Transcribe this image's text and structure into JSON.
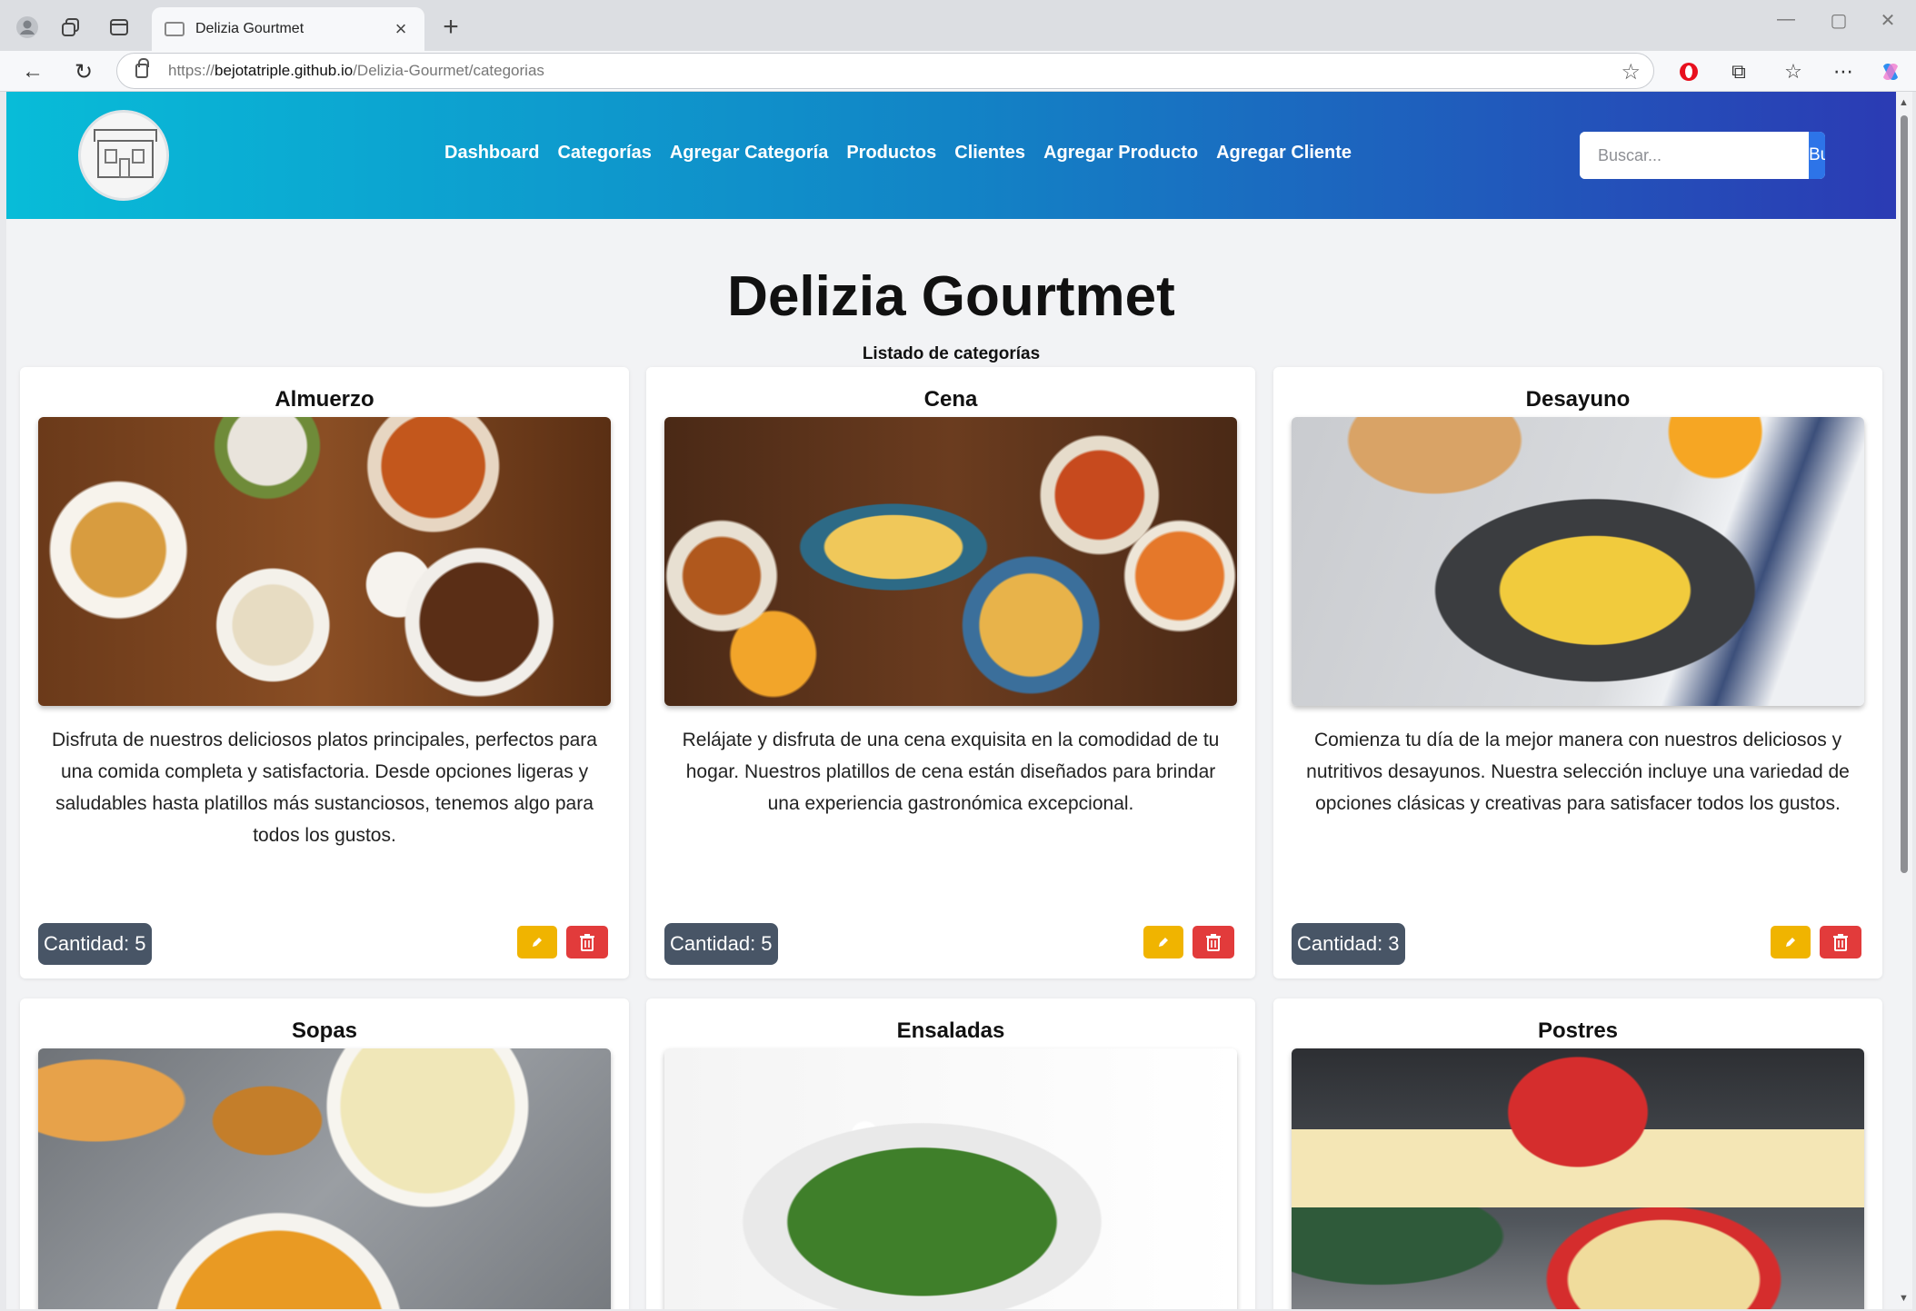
{
  "browser": {
    "tab_title": "Delizia Gourtmet",
    "url_protocol": "https://",
    "url_host": "bejotatriple.github.io",
    "url_path": "/Delizia-Gourmet/categorias"
  },
  "nav": {
    "links": [
      "Dashboard",
      "Categorías",
      "Agregar Categoría",
      "Productos",
      "Clientes",
      "Agregar Producto",
      "Agregar Cliente"
    ],
    "search_placeholder": "Buscar...",
    "search_button": "Buscar"
  },
  "page": {
    "title": "Delizia Gourtmet",
    "subtitle": "Listado de categorías"
  },
  "categories": [
    {
      "name": "Almuerzo",
      "description": "Disfruta de nuestros deliciosos platos principales, perfectos para una comida completa y satisfactoria. Desde opciones ligeras y saludables hasta platillos más sustanciosos, tenemos algo para todos los gustos.",
      "quantity": "Cantidad: 5",
      "image": "lunch"
    },
    {
      "name": "Cena",
      "description": "Relájate y disfruta de una cena exquisita en la comodidad de tu hogar. Nuestros platillos de cena están diseñados para brindar una experiencia gastronómica excepcional.",
      "quantity": "Cantidad: 5",
      "image": "dinner"
    },
    {
      "name": "Desayuno",
      "description": "Comienza tu día de la mejor manera con nuestros deliciosos y nutritivos desayunos. Nuestra selección incluye una variedad de opciones clásicas y creativas para satisfacer todos los gustos.",
      "quantity": "Cantidad: 3",
      "image": "breakfast"
    },
    {
      "name": "Sopas",
      "description": "",
      "quantity": "",
      "image": "soup"
    },
    {
      "name": "Ensaladas",
      "description": "",
      "quantity": "",
      "image": "salad"
    },
    {
      "name": "Postres",
      "description": "",
      "quantity": "",
      "image": "dessert"
    }
  ],
  "colors": {
    "header_gradient": [
      "#08bcd8",
      "#2b3bb4"
    ],
    "edit_button": "#f0b400",
    "delete_button": "#e23b3b",
    "badge": "#485566",
    "search_button": "#2d74e8"
  }
}
